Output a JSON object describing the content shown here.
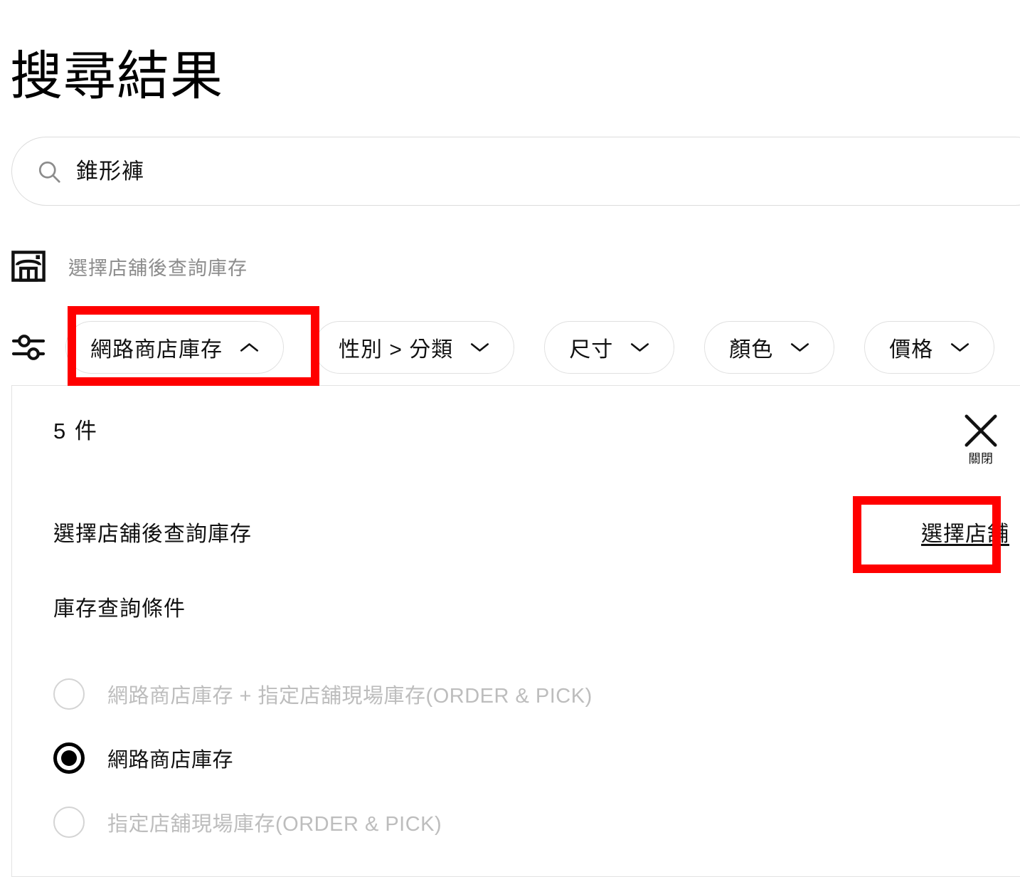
{
  "page": {
    "title": "搜尋結果"
  },
  "search": {
    "value": "錐形褲",
    "icon": "search-icon"
  },
  "store_hint": {
    "icon": "store-icon",
    "text": "選擇店舖後查詢庫存"
  },
  "filters": {
    "icon": "sliders-icon",
    "chips": [
      {
        "label": "網路商店庫存",
        "caret": "chevron-up-icon",
        "expanded": true,
        "highlighted": true
      },
      {
        "label": "性別 > 分類",
        "caret": "chevron-down-icon",
        "expanded": false,
        "highlighted": false
      },
      {
        "label": "尺寸",
        "caret": "chevron-down-icon",
        "expanded": false,
        "highlighted": false
      },
      {
        "label": "顏色",
        "caret": "chevron-down-icon",
        "expanded": false,
        "highlighted": false
      },
      {
        "label": "價格",
        "caret": "chevron-down-icon",
        "expanded": false,
        "highlighted": false
      }
    ]
  },
  "panel": {
    "count_text": "5 件",
    "close": {
      "icon": "close-icon",
      "label": "關閉"
    },
    "store_row": {
      "text": "選擇店舖後查詢庫存",
      "link_label": "選擇店舖"
    },
    "section_title": "庫存查詢條件",
    "radio_options": [
      {
        "label": "網路商店庫存 + 指定店舖現場庫存(ORDER & PICK)",
        "selected": false,
        "disabled": true
      },
      {
        "label": "網路商店庫存",
        "selected": true,
        "disabled": false
      },
      {
        "label": "指定店舖現場庫存(ORDER & PICK)",
        "selected": false,
        "disabled": true
      }
    ]
  },
  "colors": {
    "highlight": "#ff0000",
    "text": "#111111",
    "muted": "#8c8c8c",
    "disabled": "#bdbdbd",
    "border": "#e0e0e0"
  }
}
